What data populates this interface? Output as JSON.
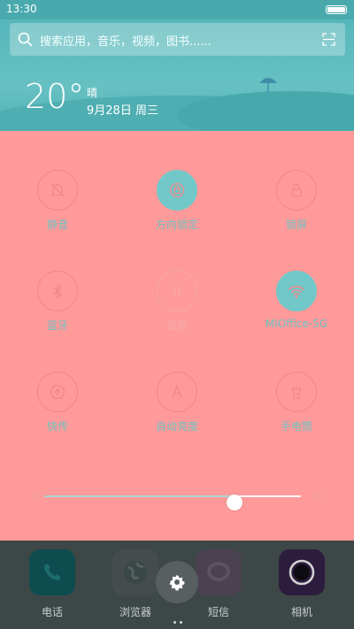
{
  "status_bar": {
    "time": "13:30"
  },
  "search": {
    "placeholder": "搜索应用，音乐，视频，图书......"
  },
  "weather": {
    "temperature": "20°",
    "condition": "晴",
    "date": "9月28日 周三"
  },
  "toggles": [
    {
      "label": "静音",
      "icon": "mute-icon",
      "state": "off"
    },
    {
      "label": "方向锁定",
      "icon": "rotation-lock-icon",
      "state": "on"
    },
    {
      "label": "锁屏",
      "icon": "lock-icon",
      "state": "off"
    },
    {
      "label": "蓝牙",
      "icon": "bluetooth-icon",
      "state": "off"
    },
    {
      "label": "数据",
      "icon": "data-icon",
      "state": "disabled"
    },
    {
      "label": "MIOffice-5G",
      "icon": "wifi-icon",
      "state": "on"
    },
    {
      "label": "快传",
      "icon": "quick-transfer-icon",
      "state": "off"
    },
    {
      "label": "自动亮度",
      "icon": "auto-brightness-icon",
      "state": "off"
    },
    {
      "label": "手电筒",
      "icon": "flashlight-icon",
      "state": "off"
    }
  ],
  "brightness": {
    "level": 0.74
  },
  "dock": [
    {
      "label": "电话",
      "icon": "phone-icon",
      "color": "#0e4c50"
    },
    {
      "label": "浏览器",
      "icon": "browser-icon",
      "color": "#454c4c"
    },
    {
      "label": "短信",
      "icon": "sms-icon",
      "color": "#4a4250"
    },
    {
      "label": "相机",
      "icon": "camera-icon",
      "color": "#2c1d3e"
    }
  ],
  "colors": {
    "panel": "#ff9a9a",
    "accent": "#72c8c8",
    "header": "#56b6ba"
  }
}
